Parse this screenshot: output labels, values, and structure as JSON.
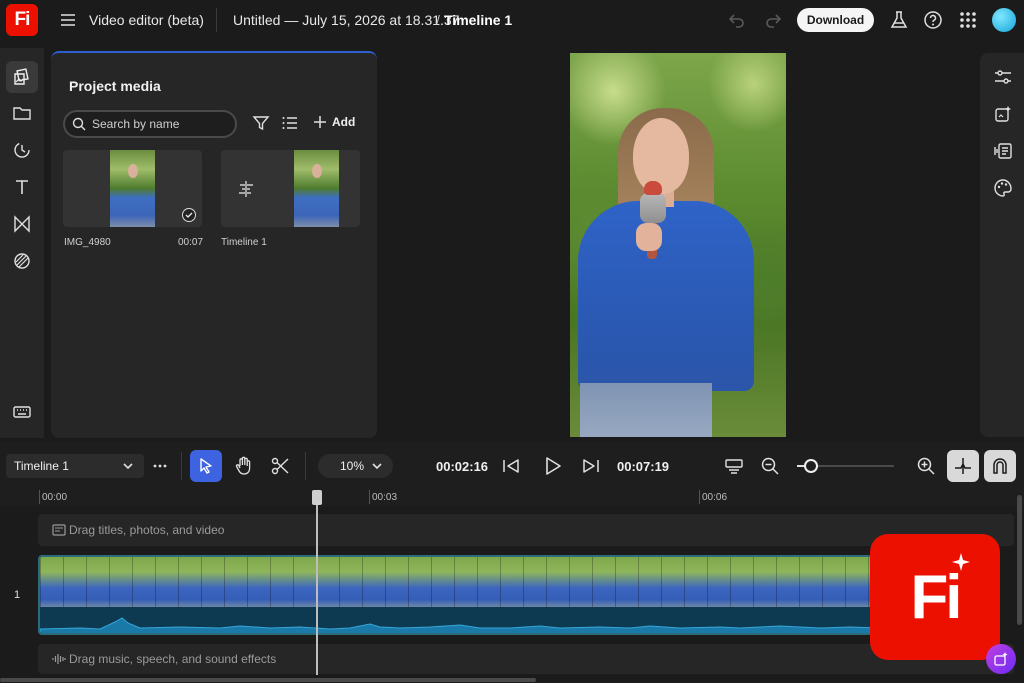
{
  "app": {
    "logo_text": "Fi",
    "title": "Video editor (beta)",
    "document_title": "Untitled — July 15, 2026 at 18.31.37",
    "separator": "/",
    "timeline_name": "Timeline 1",
    "download_label": "Download"
  },
  "left_rail": {
    "items": [
      "media-icon",
      "folder-icon",
      "stickers-icon",
      "text-icon",
      "transitions-icon",
      "effects-icon",
      "keyboard-icon"
    ]
  },
  "media_panel": {
    "title": "Project media",
    "search_placeholder": "Search by name",
    "add_label": "Add",
    "items": [
      {
        "name": "IMG_4980",
        "duration": "00:07",
        "type": "video"
      },
      {
        "name": "Timeline 1",
        "duration": "",
        "type": "timeline"
      }
    ]
  },
  "right_rail": {
    "items": [
      "adjustments-icon",
      "effects-icon",
      "captions-icon",
      "color-palette-icon"
    ]
  },
  "timeline": {
    "selector_value": "Timeline 1",
    "zoom_value": "10%",
    "current_time": "00:02:16",
    "total_time": "00:07:19",
    "ruler_ticks": [
      "00:00",
      "00:03",
      "00:06"
    ],
    "titles_hint": "Drag titles, photos, and video",
    "track_number": "1",
    "audio_hint": "Drag music, speech, and sound effects",
    "zoom_slider_level": 0.14
  },
  "overlay": {
    "badge_text": "Fi"
  },
  "colors": {
    "brand": "#eb1000",
    "accent": "#3d63e0",
    "background": "#1b1b1b",
    "panel": "#262626"
  }
}
